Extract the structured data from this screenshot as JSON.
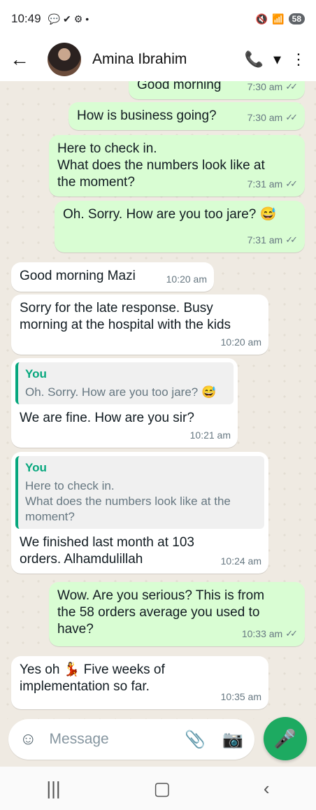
{
  "status_bar": {
    "time": "10:49",
    "battery": "58",
    "dot": "•"
  },
  "contact": {
    "name": "Amina Ibrahim"
  },
  "messages": [
    {
      "text": "Good morning",
      "time": "7:30 am"
    },
    {
      "text": "How is business going?",
      "time": "7:30 am"
    },
    {
      "text": "Here to check in.\nWhat does the numbers look like at\nthe moment?",
      "time": "7:31 am"
    },
    {
      "text": "Oh. Sorry. How are you too jare? 😅",
      "time": "7:31 am"
    },
    {
      "text": "Good morning Mazi",
      "time": "10:20 am"
    },
    {
      "text": "Sorry for the late response. Busy\nmorning at the hospital with the kids",
      "time": "10:20 am"
    },
    {
      "quote_author": "You",
      "quote_text": "Oh. Sorry. How are you too jare? 😅",
      "text": "We are fine. How are you sir?",
      "time": "10:21 am"
    },
    {
      "quote_author": "You",
      "quote_text": "Here to check in.\nWhat does the numbers look like at the\nmoment?",
      "text": "We finished last month at 103\norders. Alhamdulillah",
      "time": "10:24 am"
    },
    {
      "text": "Wow. Are you serious? This is from\nthe 58 orders average you used to\nhave?",
      "time": "10:33 am"
    },
    {
      "text": "Yes oh 💃 Five weeks of\nimplementation so far.",
      "time": "10:35 am"
    }
  ],
  "input": {
    "placeholder": "Message"
  },
  "icons": {
    "back": "←",
    "call": "📞",
    "dropdown": "▾",
    "menu": "⋮",
    "sticker": "☺",
    "attach": "📎",
    "camera": "📷",
    "mic": "🎤",
    "recents": "|||",
    "home": "▢",
    "nav_back": "‹",
    "ticks": "✓✓"
  },
  "colors": {
    "outgoing": "#d9fdd3",
    "incoming": "#ffffff",
    "accent": "#1daa61",
    "quote_bar": "#06a77d"
  }
}
